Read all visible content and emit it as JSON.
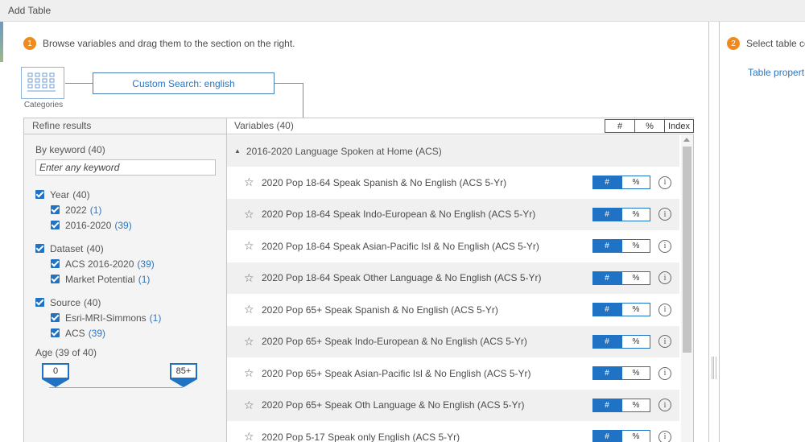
{
  "window": {
    "title": "Add Table"
  },
  "steps": [
    {
      "number": "1",
      "text": "Browse variables and drag them to the section on the right."
    },
    {
      "number": "2",
      "text": "Select table ce"
    }
  ],
  "categories": {
    "label": "Categories"
  },
  "custom_search": {
    "label": "Custom Search: english"
  },
  "refine": {
    "header": "Refine results",
    "keyword": {
      "title": "By keyword (40)",
      "placeholder": "Enter any keyword"
    },
    "groups": [
      {
        "label": "Year",
        "count": "(40)",
        "children": [
          {
            "label": "2022",
            "count": "(1)"
          },
          {
            "label": "2016-2020",
            "count": "(39)"
          }
        ]
      },
      {
        "label": "Dataset",
        "count": "(40)",
        "children": [
          {
            "label": "ACS 2016-2020",
            "count": "(39)"
          },
          {
            "label": "Market Potential",
            "count": "(1)"
          }
        ]
      },
      {
        "label": "Source",
        "count": "(40)",
        "children": [
          {
            "label": "Esri-MRI-Simmons",
            "count": "(1)"
          },
          {
            "label": "ACS",
            "count": "(39)"
          }
        ]
      }
    ],
    "age": {
      "title": "Age (39 of 40)",
      "min": "0",
      "max": "85+"
    }
  },
  "variables": {
    "header": "Variables (40)",
    "tabs": [
      "#",
      "%",
      "Index"
    ],
    "group_title": "2016-2020 Language Spoken at Home (ACS)",
    "toggle": {
      "count_label": "#",
      "percent_label": "%"
    },
    "info_glyph": "i",
    "rows": [
      "2020 Pop 18-64 Speak Spanish & No English (ACS 5-Yr)",
      "2020 Pop 18-64 Speak Indo-European & No English (ACS 5-Yr)",
      "2020 Pop 18-64 Speak Asian-Pacific Isl & No English (ACS 5-Yr)",
      "2020 Pop 18-64 Speak Other Language & No English (ACS 5-Yr)",
      "2020 Pop 65+ Speak Spanish & No English (ACS 5-Yr)",
      "2020 Pop 65+ Speak Indo-European & No English (ACS 5-Yr)",
      "2020 Pop 65+ Speak Asian-Pacific Isl & No English (ACS 5-Yr)",
      "2020 Pop 65+ Speak Oth Language & No English (ACS 5-Yr)",
      "2020 Pop 5-17 Speak only English (ACS 5-Yr)"
    ]
  },
  "right_panel": {
    "link": "Table propert"
  },
  "colors": {
    "accent": "#1f72c4",
    "step": "#f18a1c",
    "link": "#2d76be"
  }
}
